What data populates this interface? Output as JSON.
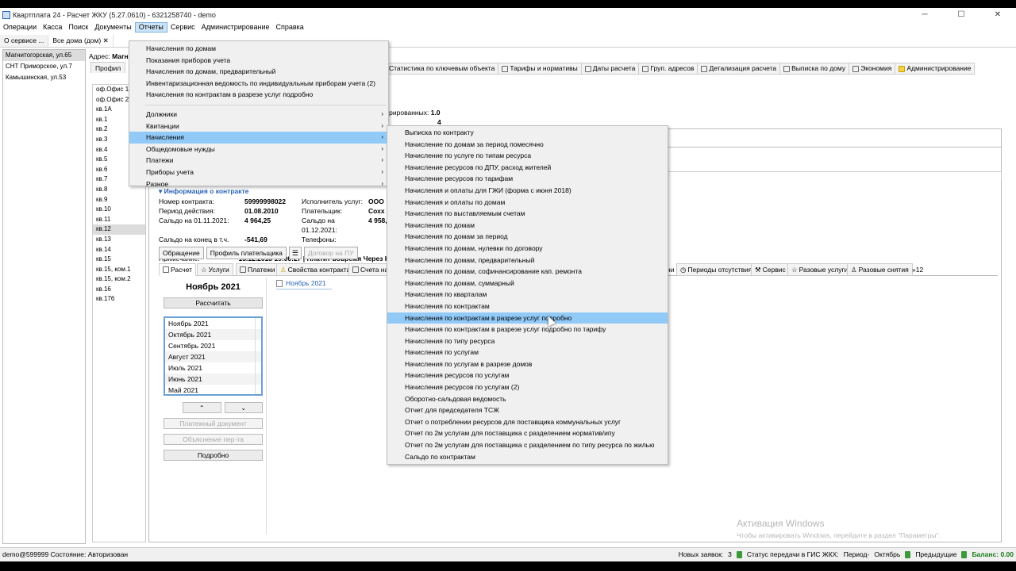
{
  "window": {
    "title": "Квартплата 24 - Расчет ЖКУ (5.27.0610) - 6321258740 - demo",
    "controls": [
      "─",
      "☐",
      "✕"
    ]
  },
  "menubar": [
    "Операции",
    "Касса",
    "Поиск",
    "Документы",
    "Отчеты",
    "Сервис",
    "Администрирование",
    "Справка"
  ],
  "doc_tabs": [
    "О сервисе ...",
    "Все дома (дом)"
  ],
  "addresses": [
    "Магнитогорская, ул.65",
    "СНТ Приморское, ул.7",
    "Камышинская, ул.53"
  ],
  "address_bar": {
    "label": "Адрес:",
    "value": "Магн"
  },
  "profile_tab": "Профил",
  "top_tabs": [
    "Статистика по ключевым объекта",
    "Тарифы и нормативы",
    "Даты расчета",
    "Груп. адресов",
    "Детализация расчета",
    "Выписка по дому",
    "Экономия",
    "Администрирование"
  ],
  "metrics": {
    "line1_label": "стрированных:",
    "line1_value": "1.0",
    "line2_value": "4"
  },
  "apartments": [
    "оф.Офис 1",
    "оф.Офис 2",
    "кв.1А",
    "кв.1",
    "кв.2",
    "кв.3",
    "кв.4",
    "кв.5",
    "кв.6",
    "кв.7",
    "кв.8",
    "кв.9",
    "кв.10",
    "кв.11",
    "кв.12",
    "кв.13",
    "кв.14",
    "кв.15",
    "кв.15, ком.1",
    "кв.15, ком.2",
    "кв.16",
    "кв.176"
  ],
  "contract": {
    "header": "Информация о контракте",
    "number_label": "Номер контракта:",
    "number_value": "59999998022",
    "executor_label": "Исполнитель услуг:",
    "executor_value": "ООО",
    "period_label": "Период действия:",
    "period_value": "01.08.2010",
    "payer_label": "Плательщик:",
    "payer_value": "Сохх",
    "saldo1_label": "Сальдо на 01.11.2021:",
    "saldo1_value": "4 964,25",
    "saldo2_label": "Сальдо на 01.12.2021:",
    "saldo2_value": "4 958,",
    "peni_label": "Сальдо на конец в т.ч. пени:",
    "peni_value": "-541,69",
    "phones_label": "Телефоны:",
    "phones_value": "",
    "note_label": "Примечание:",
    "note_value": "13.12.2018 19:00:27 | Платит вовремя Через К"
  },
  "buttons": {
    "appeals": "Обращение",
    "payer_profile": "Профиль плательщика",
    "pu_contract": "Договор на ПУ"
  },
  "sub_tabs": [
    "Расчет",
    "Услуги",
    "Платежи",
    "Свойства контракта",
    "Счета на",
    "Периоды отсутствия",
    "Сервис",
    "Разовые услуги",
    "Разовые снятия",
    "»12"
  ],
  "sub_tab_partial": "ни",
  "calc": {
    "month": "Ноябрь 2021",
    "calc_button": "Рассчитать",
    "months": [
      "Ноябрь 2021",
      "Октябрь 2021",
      "Сентябрь 2021",
      "Август 2021",
      "Июль 2021",
      "Июнь 2021",
      "Май 2021"
    ],
    "up": "⌃",
    "down": "⌄",
    "pay_doc": "Платежный документ",
    "explain": "Объяснение пер-та",
    "detail": "Подробно"
  },
  "month_tab": "Ноябрь 2021",
  "activation": {
    "title": "Активация Windows",
    "subtitle": "Чтобы активировать Windows, перейдите в раздел \"Параметры\"."
  },
  "status": {
    "left": "demo@599999 Состояние: Авторизован",
    "new_requests_label": "Новых заявок:",
    "new_requests_value": "3",
    "gis_label": "Статус передачи в ГИС ЖКХ:",
    "period_label": "Период-",
    "period_value": "Октябрь",
    "prev": "Предыдущие",
    "balance": "Баланс: 0.00"
  },
  "reports_menu": {
    "top_items": [
      "Начисления по домам",
      "Показания приборов учета",
      "Начисления по домам, предварительный",
      "Инвентаризационная ведомость по индивидуальным приборам учета (2)",
      "Начисления по контрактам в разрезе услуг подробно"
    ],
    "sub_items": [
      "Должники",
      "Квитанции",
      "Начисления",
      "Общедомовые нужды",
      "Платежи",
      "Приборы учета",
      "Разное"
    ],
    "highlighted": "Начисления"
  },
  "charges_submenu": {
    "items": [
      "Выписка по контракту",
      "Начисление по домам за период помесячно",
      "Начисление по услуге по типам ресурса",
      "Начисление ресурсов по ДПУ, расход жителей",
      "Начисление ресурсов по тарифам",
      "Начисления и оплаты для ГЖИ (форма с июня 2018)",
      "Начисления и оплаты по домам",
      "Начисления по выставляемым счетам",
      "Начисления по домам",
      "Начисления по домам за период",
      "Начисления по домам, нулевки по договору",
      "Начисления по домам, предварительный",
      "Начисления по домам, софинансирование кап. ремонта",
      "Начисления по домам, суммарный",
      "Начисления по кварталам",
      "Начисления по контрактам",
      "Начисления по контрактам в разрезе услуг подробно",
      "Начисления по контрактам в разрезе услуг подробно по тарифу",
      "Начисления по типу ресурса",
      "Начисления по услугам",
      "Начисления по услугам в разрезе домов",
      "Начисления ресурсов по услугам",
      "Начисления ресурсов по услугам (2)",
      "Оборотно-сальдовая ведомость",
      "Отчет для председателя ТСЖ",
      "Отчет о потреблении ресурсов для поставщика коммунальных услуг",
      "Отчет по 2м услугам для поставщика с разделением норматив/ипу",
      "Отчет по 2м услугам для поставщика с разделением по типу ресурса по жилью",
      "Сальдо по контрактам"
    ],
    "highlighted": "Начисления по контрактам в разрезе услуг подробно"
  }
}
